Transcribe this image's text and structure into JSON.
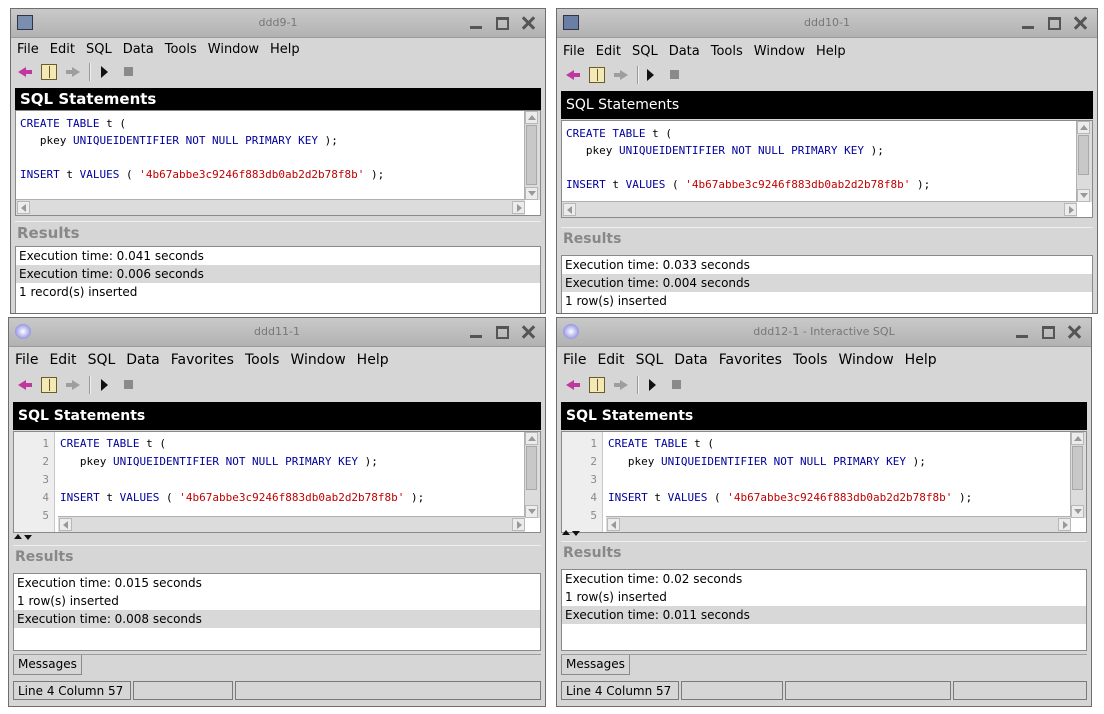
{
  "windows": [
    {
      "title": "ddd9-1",
      "menu": [
        "File",
        "Edit",
        "SQL",
        "Data",
        "Tools",
        "Window",
        "Help"
      ],
      "sql_header": "SQL Statements",
      "code_lines": [
        [
          {
            "t": "CREATE TABLE",
            "c": "kw"
          },
          {
            "t": " t ("
          }
        ],
        [
          {
            "t": "   pkey "
          },
          {
            "t": "UNIQUEIDENTIFIER NOT NULL PRIMARY KEY",
            "c": "kw"
          },
          {
            "t": " );"
          }
        ],
        [
          {
            "t": ""
          }
        ],
        [
          {
            "t": "INSERT",
            "c": "kw"
          },
          {
            "t": " t "
          },
          {
            "t": "VALUES",
            "c": "kw"
          },
          {
            "t": " ( "
          },
          {
            "t": "'4b67abbe3c9246f883db0ab2d2b78f8b'",
            "c": "str"
          },
          {
            "t": " );"
          }
        ]
      ],
      "results_header": "Results",
      "results": [
        "Execution time: 0.041 seconds",
        "Execution time: 0.006 seconds",
        "1 record(s) inserted"
      ],
      "selected_result": 1
    },
    {
      "title": "ddd10-1",
      "menu": [
        "File",
        "Edit",
        "SQL",
        "Data",
        "Tools",
        "Window",
        "Help"
      ],
      "sql_header": "SQL Statements",
      "code_lines": [
        [
          {
            "t": "CREATE TABLE",
            "c": "kw"
          },
          {
            "t": " t ("
          }
        ],
        [
          {
            "t": "   pkey "
          },
          {
            "t": "UNIQUEIDENTIFIER NOT NULL PRIMARY KEY",
            "c": "kw"
          },
          {
            "t": " );"
          }
        ],
        [
          {
            "t": ""
          }
        ],
        [
          {
            "t": "INSERT",
            "c": "kw"
          },
          {
            "t": " t "
          },
          {
            "t": "VALUES",
            "c": "kw"
          },
          {
            "t": " ( "
          },
          {
            "t": "'4b67abbe3c9246f883db0ab2d2b78f8b'",
            "c": "str"
          },
          {
            "t": " );"
          }
        ]
      ],
      "results_header": "Results",
      "results": [
        "Execution time: 0.033 seconds",
        "Execution time: 0.004 seconds",
        "1 row(s) inserted"
      ],
      "selected_result": 1
    },
    {
      "title": "ddd11-1",
      "menu": [
        "File",
        "Edit",
        "SQL",
        "Data",
        "Favorites",
        "Tools",
        "Window",
        "Help"
      ],
      "sql_header": "SQL Statements",
      "line_numbers": [
        "1",
        "2",
        "3",
        "4",
        "5"
      ],
      "code_lines": [
        [
          {
            "t": "CREATE TABLE",
            "c": "kw"
          },
          {
            "t": " t ("
          }
        ],
        [
          {
            "t": "   pkey "
          },
          {
            "t": "UNIQUEIDENTIFIER NOT NULL PRIMARY KEY",
            "c": "kw"
          },
          {
            "t": " );"
          }
        ],
        [
          {
            "t": ""
          }
        ],
        [
          {
            "t": "INSERT",
            "c": "kw"
          },
          {
            "t": " t "
          },
          {
            "t": "VALUES",
            "c": "kw"
          },
          {
            "t": " ( "
          },
          {
            "t": "'4b67abbe3c9246f883db0ab2d2b78f8b'",
            "c": "str"
          },
          {
            "t": " );"
          }
        ]
      ],
      "results_header": "Results",
      "results": [
        "Execution time: 0.015 seconds",
        "1 row(s) inserted",
        "Execution time: 0.008 seconds"
      ],
      "selected_result": 2,
      "messages_tab": "Messages",
      "status": "Line 4   Column 57"
    },
    {
      "title": "ddd12-1 - Interactive SQL",
      "menu": [
        "File",
        "Edit",
        "SQL",
        "Data",
        "Favorites",
        "Tools",
        "Window",
        "Help"
      ],
      "sql_header": "SQL Statements",
      "line_numbers": [
        "1",
        "2",
        "3",
        "4",
        "5"
      ],
      "code_lines": [
        [
          {
            "t": "CREATE TABLE",
            "c": "kw"
          },
          {
            "t": " t ("
          }
        ],
        [
          {
            "t": "   pkey "
          },
          {
            "t": "UNIQUEIDENTIFIER NOT NULL PRIMARY KEY",
            "c": "kw"
          },
          {
            "t": " );"
          }
        ],
        [
          {
            "t": ""
          }
        ],
        [
          {
            "t": "INSERT",
            "c": "kw"
          },
          {
            "t": " t "
          },
          {
            "t": "VALUES",
            "c": "kw"
          },
          {
            "t": " ( "
          },
          {
            "t": "'4b67abbe3c9246f883db0ab2d2b78f8b'",
            "c": "str"
          },
          {
            "t": " );"
          }
        ]
      ],
      "results_header": "Results",
      "results": [
        "Execution time: 0.02 seconds",
        "1 row(s) inserted",
        "Execution time: 0.011 seconds"
      ],
      "selected_result": 2,
      "messages_tab": "Messages",
      "status": "Line 4   Column 57"
    }
  ],
  "colors": {
    "keyword": "#00009c",
    "string": "#c00000",
    "header_bg": "#000000",
    "window_bg": "#d6d6d6"
  }
}
